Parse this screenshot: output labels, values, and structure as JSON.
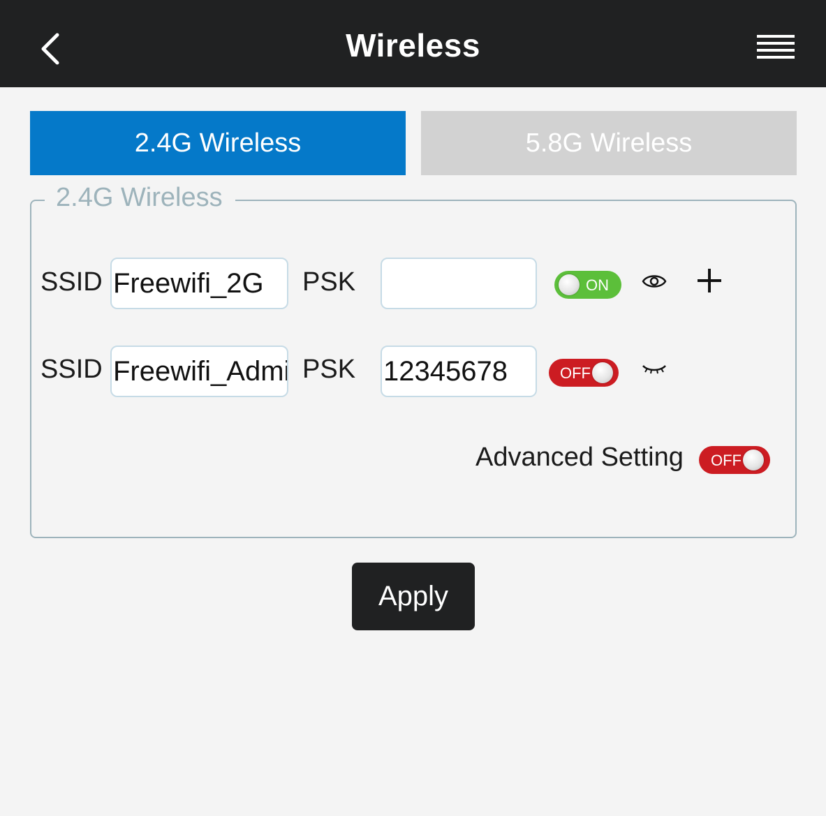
{
  "header": {
    "title": "Wireless",
    "back_icon": "chevron-left-icon",
    "menu_icon": "hamburger-menu-icon"
  },
  "tabs": [
    {
      "label": "2.4G Wireless",
      "active": true,
      "color": "#0579c9"
    },
    {
      "label": "5.8G Wireless",
      "active": false,
      "color": "#d2d2d2"
    }
  ],
  "section": {
    "legend": "2.4G Wireless",
    "rows": [
      {
        "ssid_label": "SSID",
        "ssid_value": "Freewifi_2G",
        "psk_label": "PSK",
        "psk_value": "",
        "toggle_label": "ON",
        "toggle_state": "on",
        "visibility_icon": "eye-icon",
        "add_icon": "plus-icon"
      },
      {
        "ssid_label": "SSID",
        "ssid_value": "Freewifi_Admi",
        "psk_label": "PSK",
        "psk_value": "12345678",
        "toggle_label": "OFF",
        "toggle_state": "off",
        "visibility_icon": "eye-closed-icon"
      }
    ],
    "advanced": {
      "label": "Advanced Setting",
      "toggle_label": "OFF",
      "toggle_state": "off"
    }
  },
  "apply_label": "Apply",
  "colors": {
    "header_bg": "#202122",
    "toggle_on": "#5cbf3a",
    "toggle_off": "#cc1c22"
  }
}
